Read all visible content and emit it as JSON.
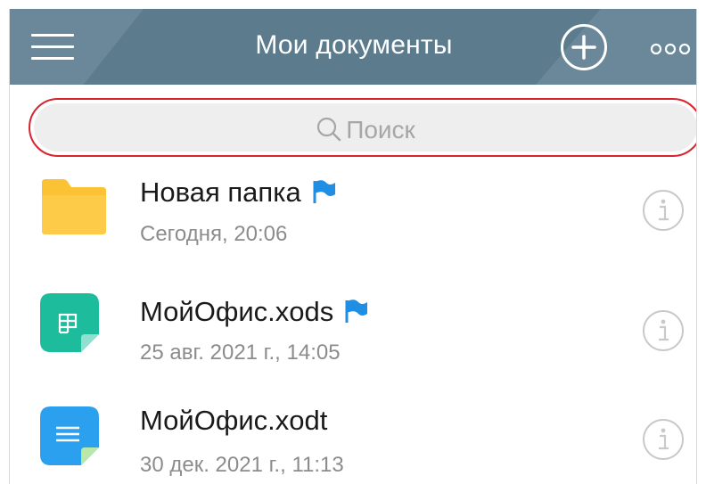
{
  "header": {
    "title": "Мои документы",
    "menu_icon": "hamburger-menu-icon",
    "add_icon": "plus-circle-icon",
    "more_icon": "more-dots-icon",
    "background": "#5c7c8e"
  },
  "search": {
    "placeholder": "Поиск",
    "icon": "search-icon",
    "highlight_color": "#d8242e"
  },
  "files": [
    {
      "name": "Новая папка",
      "date": "Сегодня, 20:06",
      "icon": "folder-icon",
      "flagged": true
    },
    {
      "name": "МойОфис.xods",
      "date": "25 авг. 2021 г., 14:05",
      "icon": "spreadsheet-document-icon",
      "flagged": true
    },
    {
      "name": "МойОфис.xodt",
      "date": "30 дек. 2021 г., 11:13",
      "icon": "text-document-icon",
      "flagged": false
    }
  ],
  "colors": {
    "flag": "#1f8fe5",
    "folder": "#fcc235",
    "spreadsheet": "#1cbc9c",
    "text_document": "#2aa0ef"
  }
}
